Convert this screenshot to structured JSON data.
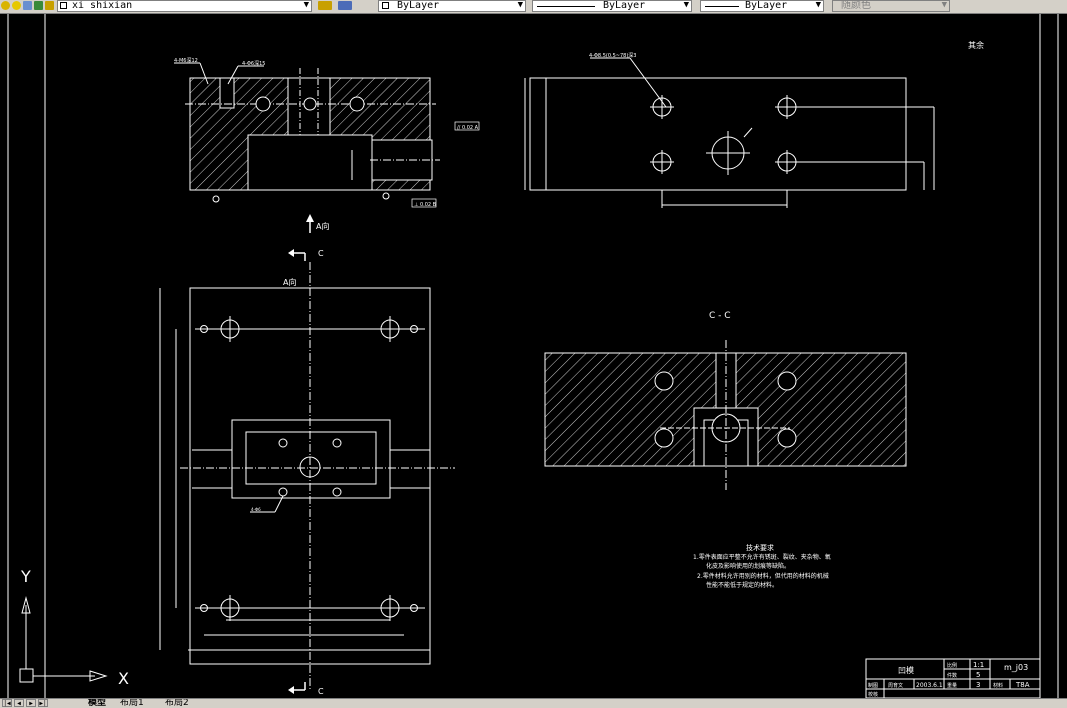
{
  "toolbar": {
    "layer_name": "xi shixian",
    "color_control": "ByLayer",
    "linetype_control": "ByLayer",
    "lineweight_control": "ByLayer",
    "plotstyle_control": "随颜色"
  },
  "drawing": {
    "top_view": {
      "leader_left": "4-M6深12",
      "leader_mid": "4-Φ6深15",
      "tol_box_1": "// 0.02 A",
      "tol_box_2": "⊥ 0.02 B",
      "arrow_label": "A向"
    },
    "front_view": {
      "leader": "4-Φ8.5(0.5~78)深3"
    },
    "plan_view": {
      "direction_label": "A向",
      "section_mark_top": "C",
      "section_mark_bottom": "C",
      "leader": "4-Φ6"
    },
    "section_view": {
      "title": "C - C"
    },
    "roughness_note": "其余",
    "tech_req": {
      "title": "技术要求",
      "line1": "1.零件表面应平整不允许有锈斑、裂纹、夹杂物、氧",
      "line2": "化皮及影响使用的划痕等缺陷。",
      "line3": "2.零件材料允许用别的材料，但代用的材料的机械",
      "line4": "性能不能低于规定的材料。"
    },
    "title_block": {
      "part_name": "凹模",
      "scale_label": "比例",
      "scale_value": "1:1",
      "qty_label": "件数",
      "qty_value": "5",
      "drawing_no": "m_j03",
      "drawn_label": "制图",
      "drawn_name": "周育文",
      "drawn_date": "2003.6.1",
      "weight_label": "重量",
      "weight_value": "3",
      "material_label": "材料",
      "material_value": "T8A",
      "check_label": "校核"
    },
    "ucs": {
      "x_label": "X",
      "y_label": "Y"
    }
  },
  "statusbar": {
    "tabs": [
      "模型",
      "布局1",
      "布局2"
    ]
  }
}
